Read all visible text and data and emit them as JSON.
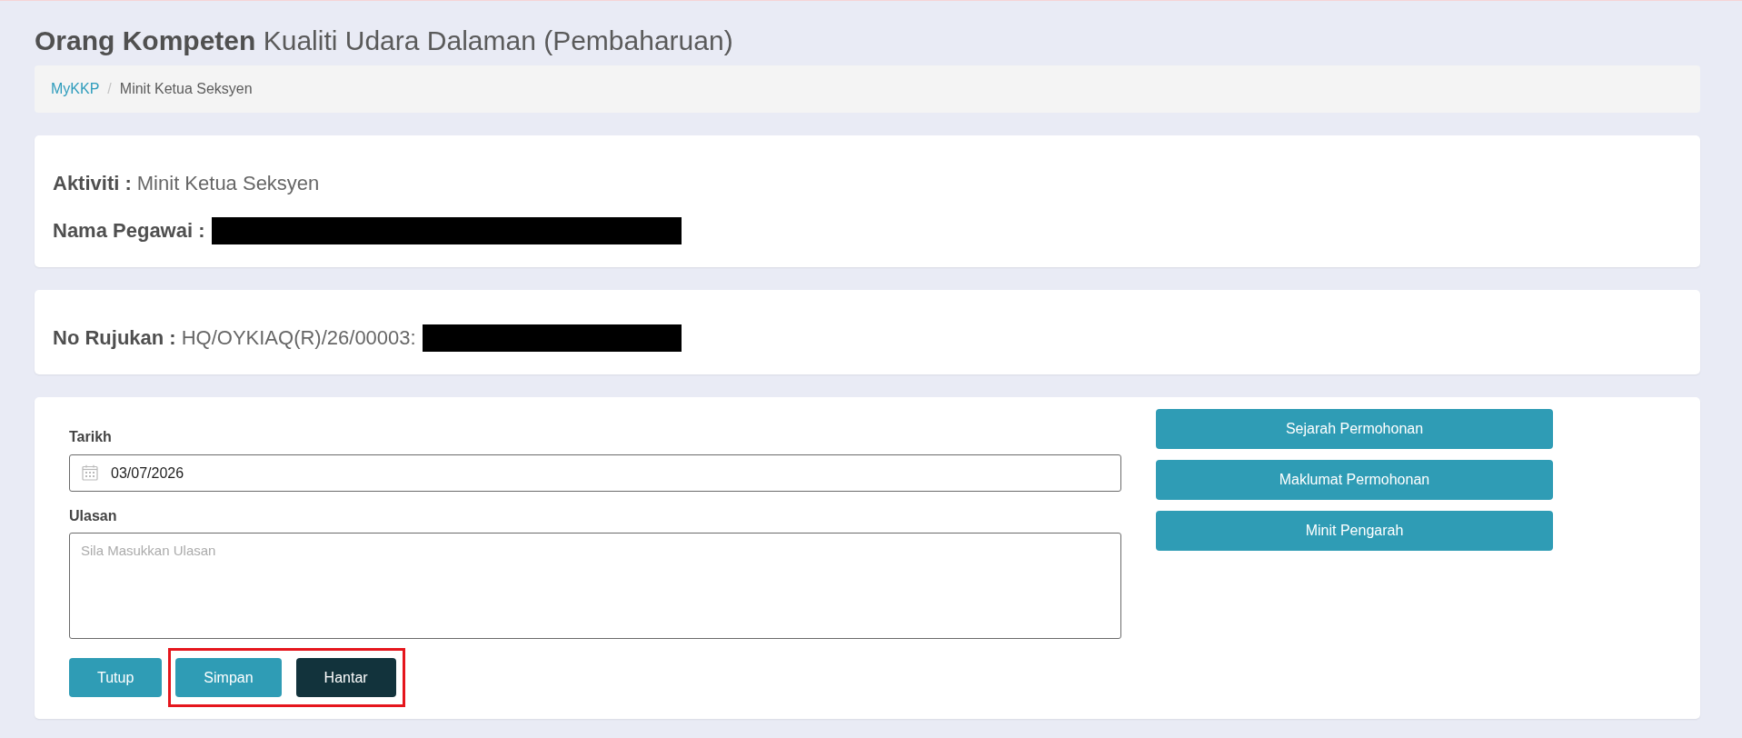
{
  "title": "**Orang Kompeten** Kualiti Udara Dalaman (Pembaharuan)",
  "breadcrumb": {
    "separator": "/",
    "items": [
      {
        "label": "MyKKP",
        "active": false
      },
      {
        "label": "Minit Ketua Seksyen",
        "active": true
      }
    ]
  },
  "summary_cards": [
    {
      "rows": [
        {
          "label": "Aktiviti :",
          "value": "Minit Ketua Seksyen"
        },
        {
          "label": "Nama Pegawai :",
          "redacted": true
        }
      ]
    },
    {
      "rows": [
        {
          "label": "No Rujukan :",
          "value": "HQ/OYKIAQ(R)/26/00003:",
          "redacted": true
        }
      ]
    }
  ],
  "form": {
    "fields": [
      {
        "kind": "date",
        "label": "Tarikh",
        "value": "03/07/2026"
      },
      {
        "kind": "textarea",
        "label": "Ulasan",
        "placeholder": "Sila Masukkan Ulasan"
      }
    ],
    "actions": [
      {
        "label": "Tutup",
        "kind": "primary",
        "highlighted": false
      },
      {
        "label": "Simpan",
        "kind": "primary",
        "highlighted": true
      },
      {
        "label": "Hantar",
        "kind": "dark",
        "highlighted": true
      }
    ],
    "side_buttons": [
      "Sejarah Permohonan",
      "Maklumat Permohonan",
      "Minit Pengarah"
    ]
  }
}
